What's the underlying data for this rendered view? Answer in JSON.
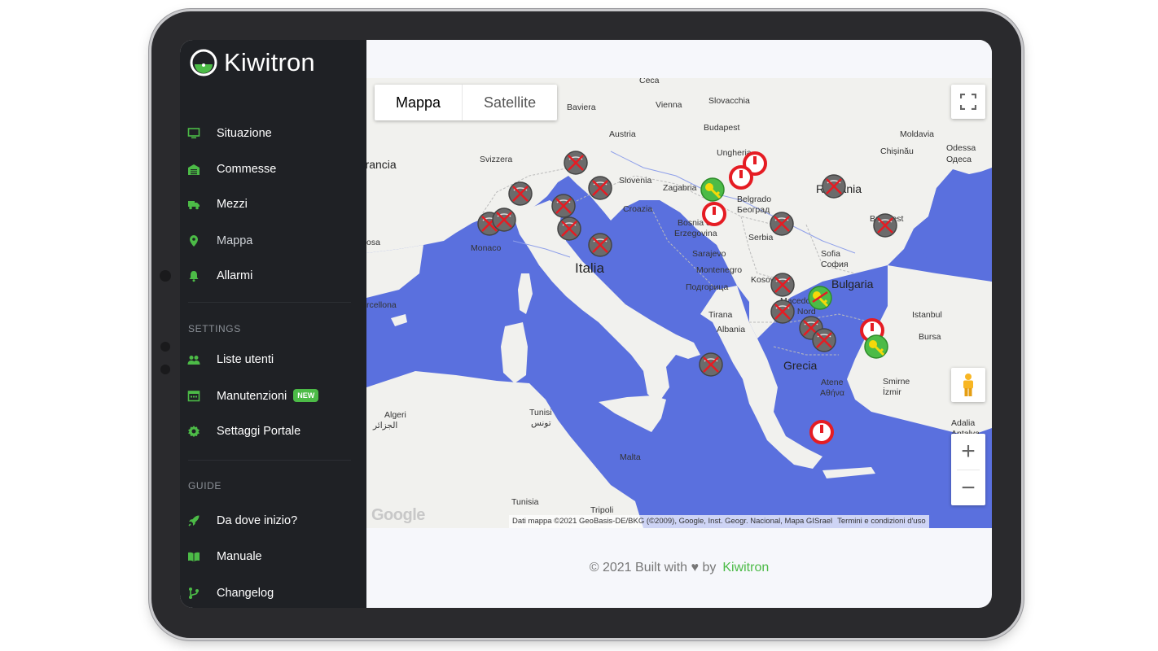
{
  "brand": {
    "name": "Kiwitron"
  },
  "sidebar": {
    "main": [
      {
        "label": "Situazione",
        "icon": "monitor-icon"
      },
      {
        "label": "Commesse",
        "icon": "warehouse-icon"
      },
      {
        "label": "Mezzi",
        "icon": "truck-icon"
      },
      {
        "label": "Mappa",
        "icon": "map-pin-icon"
      },
      {
        "label": "Allarmi",
        "icon": "bell-icon"
      }
    ],
    "settings_title": "SETTINGS",
    "settings": [
      {
        "label": "Liste utenti",
        "icon": "users-icon"
      },
      {
        "label": "Manutenzioni",
        "icon": "calendar-icon",
        "badge": "NEW"
      },
      {
        "label": "Settaggi Portale",
        "icon": "gear-icon"
      }
    ],
    "guide_title": "GUIDE",
    "guide": [
      {
        "label": "Da dove inizio?",
        "icon": "rocket-icon"
      },
      {
        "label": "Manuale",
        "icon": "book-icon"
      },
      {
        "label": "Changelog",
        "icon": "git-branch-icon"
      }
    ]
  },
  "map": {
    "type_options": {
      "map": "Mappa",
      "satellite": "Satellite"
    },
    "selected_type": "Mappa",
    "labels": {
      "ceca": "Ceca",
      "baviera": "Baviera",
      "vienna": "Vienna",
      "slovacchia": "Slovacchia",
      "austria": "Austria",
      "budapest": "Budapest",
      "moldavia": "Moldavia",
      "ungheria": "Ungheria",
      "chisinau": "Chișinău",
      "odessa": "Odessa",
      "odessa_cyr": "Одеса",
      "francia": "Francia",
      "svizzera": "Svizzera",
      "slovenia": "Slovenia",
      "zagabria": "Zagabria",
      "romania": "Romania",
      "belgrado": "Belgrado",
      "belgrado_cyr": "Београд",
      "croazia": "Croazia",
      "bosnia": "Bosnia ed",
      "erzegovina": "Erzegovina",
      "serbia": "Serbia",
      "bucarest": "Bucarest",
      "monaco": "Monaco",
      "italia": "Italia",
      "sarajevo": "Sarajevo",
      "sofia": "Sofia",
      "sofia_cyr": "София",
      "bulgaria": "Bulgaria",
      "montenegro": "Montenegro",
      "kosovo": "Kosovo",
      "macedonia": "Macedonia",
      "del_nord": "del Nord",
      "podgorica": "Подгорица",
      "tirana": "Tirana",
      "albania": "Albania",
      "istanbul": "Istanbul",
      "bursa": "Bursa",
      "barcellona": "rcellona",
      "grecia": "Grecia",
      "atene": "Atene",
      "atene_gr": "Αθήνα",
      "smirne": "Smirne",
      "izmir": "İzmir",
      "algeri": "Algeri",
      "algeri_ar": "الجزائر",
      "tunisi": "Tunisi",
      "tunisi_ar": "تونس",
      "malta": "Malta",
      "tunisia": "Tunisia",
      "tripoli": "Tripoli",
      "adalia": "Adalia",
      "antalya": "Antalya",
      "losa": "osa"
    },
    "attribution": "Dati mappa ©2021 GeoBasis-DE/BKG (©2009), Google, Inst. Geogr. Nacional, Mapa GISrael",
    "terms": "Termini e condizioni d'uso",
    "google": "Google",
    "zoom_in": "+",
    "zoom_out": "−"
  },
  "footer": {
    "text": "© 2021 Built with ♥ by",
    "brand": "Kiwitron"
  },
  "colors": {
    "accent": "#4cbb47",
    "sidebar_bg": "#1f2125",
    "sea": "#5a70de",
    "land": "#f1f1ee"
  }
}
